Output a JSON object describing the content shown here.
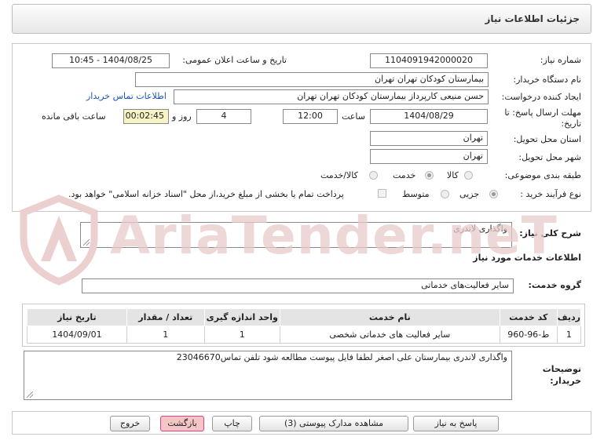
{
  "header": {
    "title": "جزئیات اطلاعات نیاز"
  },
  "form": {
    "need_number_label": "شماره نیاز:",
    "need_number": "1104091942000020",
    "announce_label": "تاریخ و ساعت اعلان عمومی:",
    "announce_value": "1404/08/25 - 10:45",
    "buyer_org_label": "نام دستگاه خریدار:",
    "buyer_org": "بیمارستان کودکان تهران تهران",
    "creator_label": "ایجاد کننده درخواست:",
    "creator": "حسن منیعی کارپرداز بیمارستان کودکان تهران تهران",
    "contact_link": "اطلاعات تماس خریدار",
    "deadline_label_1": "مهلت ارسال پاسخ: تا",
    "deadline_label_2": "تاریخ:",
    "deadline_date": "1404/08/29",
    "time_label": "ساعت",
    "deadline_time": "12:00",
    "days_value": "4",
    "days_label": "روز و",
    "remaining_value": "00:02:45",
    "remaining_label": "ساعت باقی مانده",
    "province_label": "استان محل تحویل:",
    "province": "تهران",
    "city_label": "شهر محل تحویل:",
    "city": "تهران",
    "category_label": "طبقه بندی موضوعی:",
    "category_options": [
      "کالا",
      "خدمت",
      "کالا/خدمت"
    ],
    "category_selected": "خدمت",
    "process_label": "نوع فرآیند خرید :",
    "process_options": [
      "جزیی",
      "متوسط"
    ],
    "process_selected": "جزیی",
    "treasury_note": "پرداخت تمام یا بخشی از مبلغ خرید،از محل \"اسناد خزانه اسلامی\" خواهد بود."
  },
  "summary": {
    "label": "شرح کلی نیاز:",
    "value": "واگذاری لاندری"
  },
  "services_section": {
    "title": "اطلاعات خدمات مورد نیاز",
    "group_label": "گروه خدمت:",
    "group_value": "سایر فعالیت‌های خدماتی",
    "table": {
      "headers": [
        "ردیف",
        "کد خدمت",
        "نام خدمت",
        "واحد اندازه گیری",
        "تعداد / مقدار",
        "تاریخ نیاز"
      ],
      "rows": [
        [
          "1",
          "ط-96-960",
          "سایر فعالیت های خدماتی شخصی",
          "1",
          "1",
          "1404/09/01"
        ]
      ]
    }
  },
  "buyer_notes": {
    "label_1": "توضیحات",
    "label_2": "خریدار:",
    "value": "واگذاری لاندری بیمارستان علی اصغر لطفا فایل پیوست مطالعه شود تلفن تماس23046670"
  },
  "buttons": {
    "reply": "پاسخ به نیاز",
    "attachments": "مشاهده مدارک پیوستی (3)",
    "print": "چاپ",
    "back": "بازگشت",
    "exit": "خروج"
  },
  "watermark": {
    "text": "AriaTender.neT"
  },
  "colors": {
    "link": "#1b53b5",
    "remaining_bg": "#f7f3c4",
    "watermark": "#e9caca"
  }
}
